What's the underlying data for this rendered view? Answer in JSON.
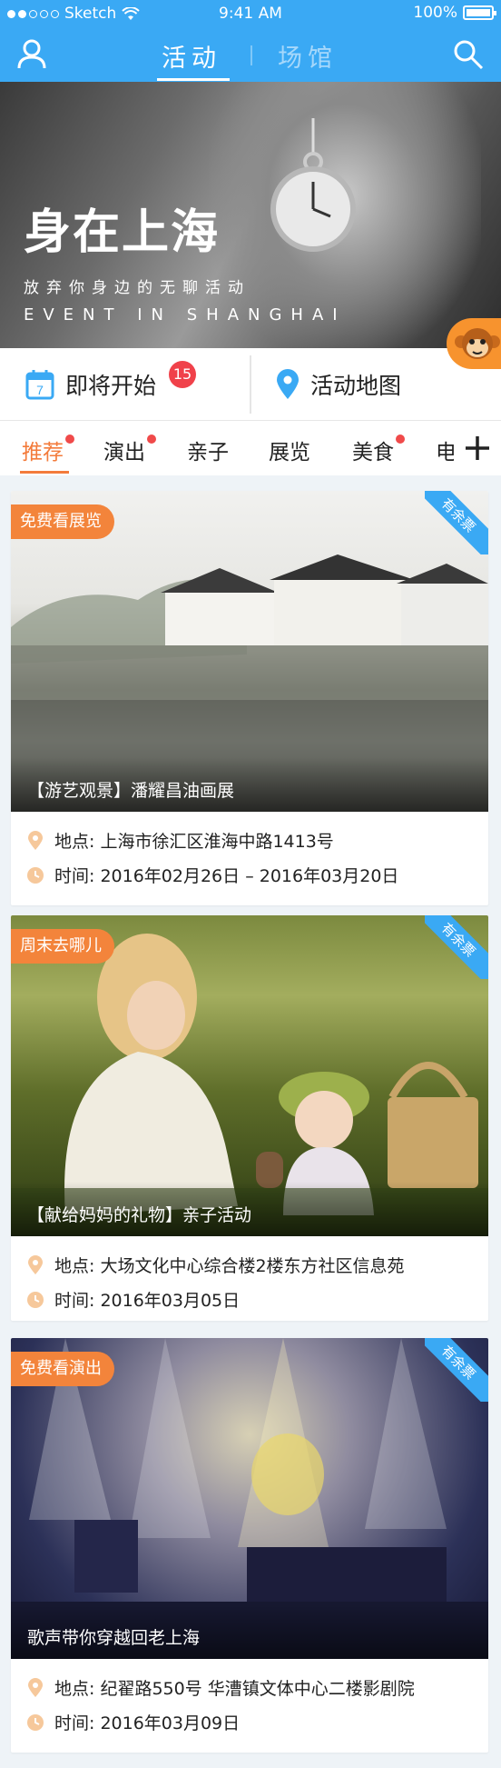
{
  "status_bar": {
    "carrier": "Sketch",
    "time": "9:41 AM",
    "battery": "100%"
  },
  "header": {
    "tabs": [
      {
        "label": "活动",
        "active": true
      },
      {
        "label": "场馆",
        "active": false
      }
    ],
    "user_icon": "user-icon",
    "search_icon": "search-icon"
  },
  "hero": {
    "title": "身在上海",
    "subtitle": "放弃你身边的无聊活动",
    "subtitle_en": "EVENT IN SHANGHAI"
  },
  "quick_actions": {
    "upcoming": {
      "label": "即将开始",
      "badge": "15",
      "icon": "calendar-icon",
      "calendar_day": "7"
    },
    "map": {
      "label": "活动地图",
      "icon": "location-pin-icon"
    }
  },
  "categories": [
    {
      "label": "推荐",
      "active": true,
      "dot": true
    },
    {
      "label": "演出",
      "active": false,
      "dot": true
    },
    {
      "label": "亲子",
      "active": false,
      "dot": false
    },
    {
      "label": "展览",
      "active": false,
      "dot": false
    },
    {
      "label": "美食",
      "active": false,
      "dot": true
    },
    {
      "label": "电",
      "active": false,
      "dot": false
    }
  ],
  "cards": [
    {
      "tag": "免费看展览",
      "ribbon": "有余票",
      "caption": "【游艺观景】潘耀昌油画展",
      "location": "地点: 上海市徐汇区淮海中路1413号",
      "time": "时间: 2016年02月26日 – 2016年03月20日"
    },
    {
      "tag": "周末去哪儿",
      "ribbon": "有余票",
      "caption": "【献给妈妈的礼物】亲子活动",
      "location": "地点: 大场文化中心综合楼2楼东方社区信息苑",
      "time": "时间: 2016年03月05日"
    },
    {
      "tag": "免费看演出",
      "ribbon": "有余票",
      "caption": "歌声带你穿越回老上海",
      "location": "地点: 纪翟路550号 华漕镇文体中心二楼影剧院",
      "time": "时间: 2016年03月09日"
    }
  ],
  "colors": {
    "primary": "#3aa9f4",
    "accent": "#f37b3b",
    "badge": "#f0414a"
  }
}
